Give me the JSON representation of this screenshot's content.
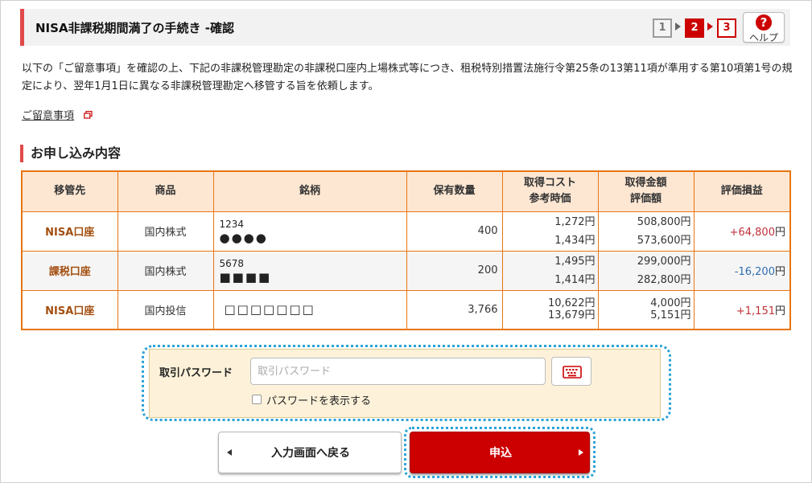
{
  "header": {
    "title": "NISA非課税期間満了の手続き -確認",
    "steps": [
      "1",
      "2",
      "3"
    ],
    "help_label": "ヘルプ",
    "help_glyph": "?"
  },
  "intro": "以下の「ご留意事項」を確認の上、下記の非課税管理勘定の非課税口座内上場株式等につき、租税特別措置法施行令第25条の13第11項が準用する第10項第1号の規定により、翌年1月1日に異なる非課税管理勘定へ移管する旨を依頼します。",
  "note_link": "ご留意事項",
  "section_title": "お申し込み内容",
  "table": {
    "headers": {
      "dest": "移管先",
      "product": "商品",
      "name": "銘柄",
      "qty": "保有数量",
      "cost_line1": "取得コスト",
      "cost_line2": "参考時価",
      "amount_line1": "取得金額",
      "amount_line2": "評価額",
      "pl": "評価損益"
    },
    "unit": "円",
    "rows": [
      {
        "dest": "NISA口座",
        "product": "国内株式",
        "code": "1234",
        "mask": "●●●●",
        "qty": "400",
        "cost": "1,272",
        "price": "1,434",
        "acq": "508,800",
        "val": "573,600",
        "pl": "+64,800",
        "sign": "pos"
      },
      {
        "dest": "課税口座",
        "product": "国内株式",
        "code": "5678",
        "mask": "■■■■",
        "qty": "200",
        "cost": "1,495",
        "price": "1,414",
        "acq": "299,000",
        "val": "282,800",
        "pl": "-16,200",
        "sign": "neg"
      },
      {
        "dest": "NISA口座",
        "product": "国内投信",
        "code": "",
        "mask": "□□□□□□□",
        "qty": "3,766",
        "cost": "10,622",
        "price": "13,679",
        "acq": "4,000",
        "val": "5,151",
        "pl": "+1,151",
        "sign": "pos"
      }
    ]
  },
  "password": {
    "label": "取引パスワード",
    "placeholder": "取引パスワード",
    "value": "",
    "show_label": "パスワードを表示する",
    "keyboard_icon": "software-keyboard-icon"
  },
  "buttons": {
    "back": "入力画面へ戻る",
    "submit": "申込"
  },
  "colors": {
    "accent_red": "#cc0000",
    "table_border": "#e87511",
    "header_bg": "#fde7d3",
    "focus_ring": "#2aa3d8",
    "positive": "#c0303a",
    "negative": "#2e6fb0"
  }
}
